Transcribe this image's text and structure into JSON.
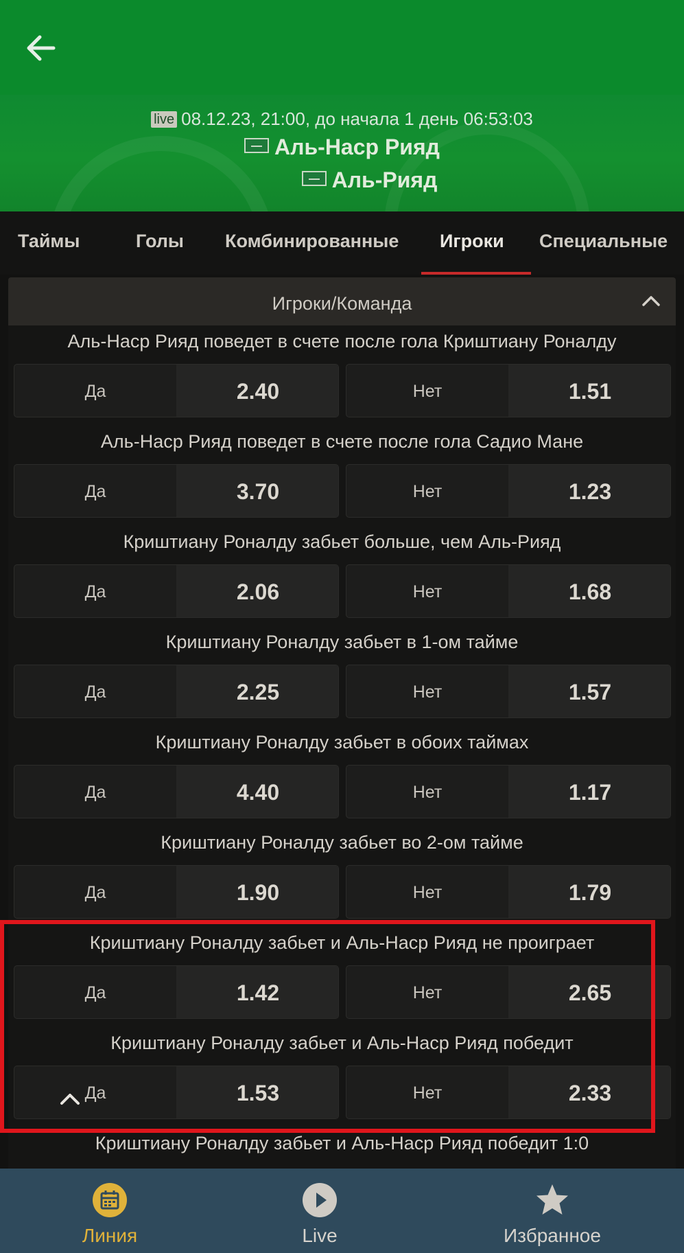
{
  "header": {
    "live_badge": "live",
    "match_time": "08.12.23, 21:00, до начала  1 день  06:53:03",
    "team_home": "Аль-Наср Рияд",
    "team_away": "Аль-Рияд",
    "back_icon": "arrow-left-icon"
  },
  "tabs": [
    {
      "label": "Таймы"
    },
    {
      "label": "Голы"
    },
    {
      "label": "Комбинированные"
    },
    {
      "label": "Игроки",
      "active": true
    },
    {
      "label": "Специальные"
    }
  ],
  "section": {
    "title": "Игроки/Команда",
    "toggle_icon": "chevron-up-icon"
  },
  "markets": [
    {
      "title": "Аль-Наср Рияд поведет в счете после гола Криштиану Роналду",
      "yes_label": "Да",
      "yes_odds": "2.40",
      "no_label": "Нет",
      "no_odds": "1.51"
    },
    {
      "title": "Аль-Наср Рияд поведет в счете после гола Садио Мане",
      "yes_label": "Да",
      "yes_odds": "3.70",
      "no_label": "Нет",
      "no_odds": "1.23"
    },
    {
      "title": "Криштиану Роналду забьет больше, чем Аль-Рияд",
      "yes_label": "Да",
      "yes_odds": "2.06",
      "no_label": "Нет",
      "no_odds": "1.68"
    },
    {
      "title": "Криштиану Роналду забьет в 1-ом тайме",
      "yes_label": "Да",
      "yes_odds": "2.25",
      "no_label": "Нет",
      "no_odds": "1.57"
    },
    {
      "title": "Криштиану Роналду забьет в обоих таймах",
      "yes_label": "Да",
      "yes_odds": "4.40",
      "no_label": "Нет",
      "no_odds": "1.17"
    },
    {
      "title": "Криштиану Роналду забьет во 2-ом тайме",
      "yes_label": "Да",
      "yes_odds": "1.90",
      "no_label": "Нет",
      "no_odds": "1.79"
    },
    {
      "title": "Криштиану Роналду забьет и Аль-Наср Рияд не проиграет",
      "yes_label": "Да",
      "yes_odds": "1.42",
      "no_label": "Нет",
      "no_odds": "2.65"
    },
    {
      "title": "Криштиану Роналду забьет и Аль-Наср Рияд победит",
      "yes_label": "Да",
      "yes_odds": "1.53",
      "no_label": "Нет",
      "no_odds": "2.33"
    },
    {
      "title": "Криштиану Роналду забьет и Аль-Наср Рияд победит 1:0"
    }
  ],
  "bottom_nav": [
    {
      "label": "Линия",
      "icon": "calendar-icon",
      "active": true
    },
    {
      "label": "Live",
      "icon": "play-icon"
    },
    {
      "label": "Избранное",
      "icon": "star-icon"
    }
  ],
  "colors": {
    "header_green": "#0b8a2c",
    "active_tab_underline": "#c62a2a",
    "highlight_red": "#e0161c",
    "nav_bg": "#2f4a5c",
    "nav_active": "#e0b23a"
  }
}
